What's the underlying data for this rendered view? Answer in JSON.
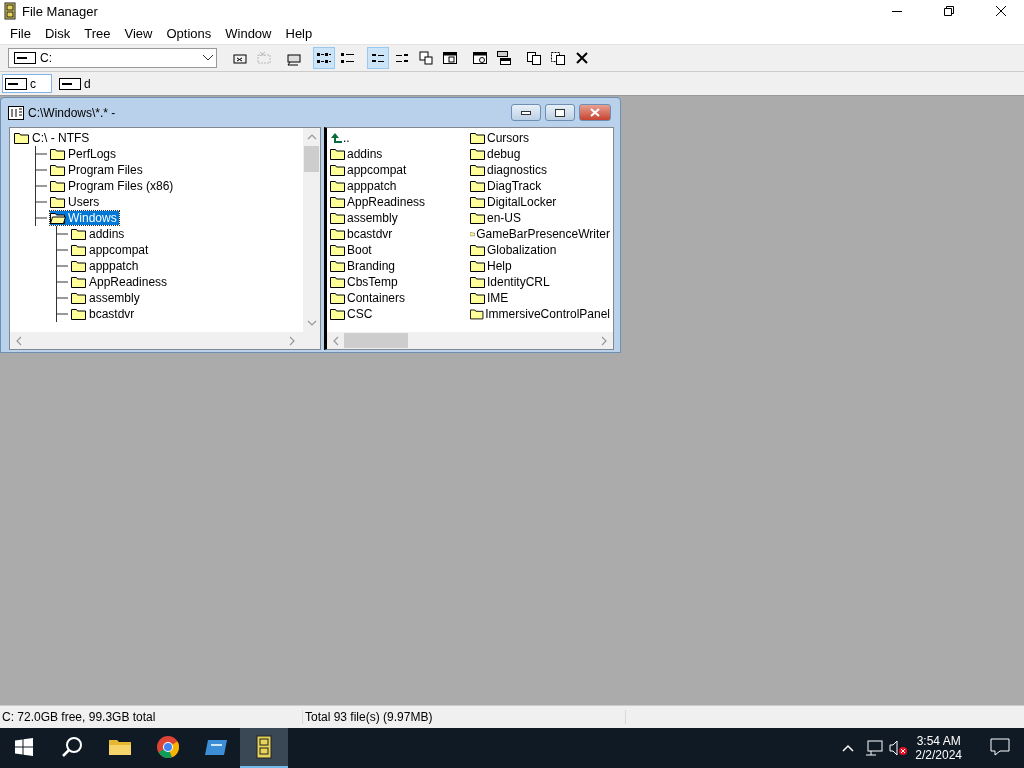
{
  "window": {
    "title": "File Manager"
  },
  "menu": [
    "File",
    "Disk",
    "Tree",
    "View",
    "Options",
    "Window",
    "Help"
  ],
  "drive_select": {
    "value": "C:"
  },
  "toolbar": [
    {
      "kind": "connect",
      "selected": false,
      "disabled": false
    },
    {
      "kind": "disconnect",
      "selected": false,
      "disabled": true
    },
    {
      "kind": "share",
      "selected": false,
      "disabled": false
    },
    {
      "kind": "icons",
      "selected": true,
      "disabled": false
    },
    {
      "kind": "details",
      "selected": false,
      "disabled": false
    },
    {
      "kind": "sortname",
      "selected": true,
      "disabled": false
    },
    {
      "kind": "sorttype",
      "selected": false,
      "disabled": false
    },
    {
      "kind": "newwin",
      "selected": false,
      "disabled": false
    },
    {
      "kind": "sortsize",
      "selected": false,
      "disabled": false
    },
    {
      "kind": "sortdate",
      "selected": false,
      "disabled": false
    },
    {
      "kind": "cascade",
      "selected": false,
      "disabled": false
    },
    {
      "kind": "copy",
      "selected": false,
      "disabled": false
    },
    {
      "kind": "paste",
      "selected": false,
      "disabled": false
    },
    {
      "kind": "delete",
      "selected": false,
      "disabled": false
    }
  ],
  "drives": [
    {
      "label": "c",
      "selected": true
    },
    {
      "label": "d",
      "selected": false
    }
  ],
  "child_window": {
    "title": "C:\\Windows\\*.* -",
    "tree": [
      {
        "label": "C:\\ - NTFS",
        "selected": false,
        "children": [
          {
            "label": "PerfLogs",
            "selected": false
          },
          {
            "label": "Program Files",
            "selected": false
          },
          {
            "label": "Program Files (x86)",
            "selected": false
          },
          {
            "label": "Users",
            "selected": false
          },
          {
            "label": "Windows",
            "selected": true,
            "children": [
              {
                "label": "addins",
                "selected": false
              },
              {
                "label": "appcompat",
                "selected": false
              },
              {
                "label": "apppatch",
                "selected": false
              },
              {
                "label": "AppReadiness",
                "selected": false
              },
              {
                "label": "assembly",
                "selected": false
              },
              {
                "label": "bcastdvr",
                "selected": false
              }
            ]
          }
        ]
      }
    ],
    "files": [
      {
        "name": "..",
        "kind": "up"
      },
      {
        "name": "addins",
        "kind": "folder"
      },
      {
        "name": "appcompat",
        "kind": "folder"
      },
      {
        "name": "apppatch",
        "kind": "folder"
      },
      {
        "name": "AppReadiness",
        "kind": "folder"
      },
      {
        "name": "assembly",
        "kind": "folder"
      },
      {
        "name": "bcastdvr",
        "kind": "folder"
      },
      {
        "name": "Boot",
        "kind": "folder"
      },
      {
        "name": "Branding",
        "kind": "folder"
      },
      {
        "name": "CbsTemp",
        "kind": "folder"
      },
      {
        "name": "Containers",
        "kind": "folder"
      },
      {
        "name": "CSC",
        "kind": "folder"
      },
      {
        "name": "Cursors",
        "kind": "folder"
      },
      {
        "name": "debug",
        "kind": "folder"
      },
      {
        "name": "diagnostics",
        "kind": "folder"
      },
      {
        "name": "DiagTrack",
        "kind": "folder"
      },
      {
        "name": "DigitalLocker",
        "kind": "folder"
      },
      {
        "name": "en-US",
        "kind": "folder"
      },
      {
        "name": "GameBarPresenceWriter",
        "kind": "folder"
      },
      {
        "name": "Globalization",
        "kind": "folder"
      },
      {
        "name": "Help",
        "kind": "folder"
      },
      {
        "name": "IdentityCRL",
        "kind": "folder"
      },
      {
        "name": "IME",
        "kind": "folder"
      },
      {
        "name": "ImmersiveControlPanel",
        "kind": "folder"
      }
    ]
  },
  "status_bar": [
    "C: 72.0GB free,  99.3GB total",
    "Total 93 file(s) (9.97MB)"
  ],
  "taskbar": {
    "apps": [
      {
        "kind": "folder",
        "selected": false
      },
      {
        "kind": "browser",
        "selected": false
      },
      {
        "kind": "card",
        "selected": false
      },
      {
        "kind": "cabinet",
        "selected": true
      }
    ],
    "time": "3:54 AM",
    "date": "2/2/2024"
  }
}
